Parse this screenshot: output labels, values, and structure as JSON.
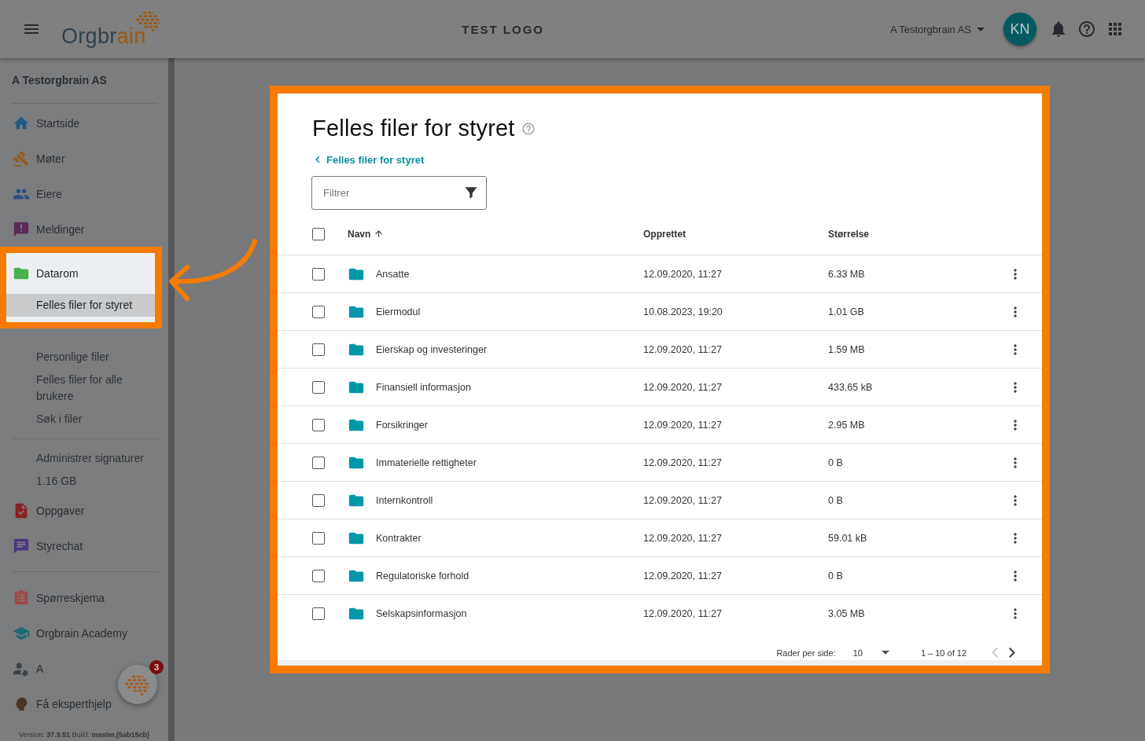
{
  "header": {
    "logo": [
      "Orgbr",
      "ain"
    ],
    "center_title": "TEST LOGO",
    "org_selector": "A Testorgbrain AS",
    "avatar": "KN"
  },
  "sidebar": {
    "org": "A Testorgbrain AS",
    "items": [
      {
        "kind": "nav",
        "label": "Startside",
        "selected": false,
        "highlighted": false
      },
      {
        "kind": "nav",
        "label": "Møter",
        "selected": false,
        "highlighted": false
      },
      {
        "kind": "nav",
        "label": "Eiere",
        "selected": false,
        "highlighted": false
      },
      {
        "kind": "nav",
        "label": "Meldinger",
        "selected": false,
        "highlighted": false
      },
      {
        "kind": "nav",
        "label": "Datarom",
        "selected": false,
        "highlighted": true
      },
      {
        "kind": "sub",
        "label": "Felles filer for styret",
        "selected": true,
        "highlighted": true
      },
      {
        "kind": "sub",
        "label": "Personlige filer",
        "selected": false,
        "highlighted": false
      },
      {
        "kind": "sub",
        "label": "Felles filer for alle brukere",
        "selected": false,
        "highlighted": false
      },
      {
        "kind": "sub",
        "label": "Søk i filer",
        "selected": false,
        "highlighted": false
      },
      {
        "kind": "divider"
      },
      {
        "kind": "sub",
        "label": "Administrer signaturer",
        "selected": false,
        "highlighted": false
      },
      {
        "kind": "sub",
        "label": "1.16 GB",
        "selected": false,
        "highlighted": false
      },
      {
        "kind": "nav",
        "label": "Oppgaver",
        "selected": false,
        "highlighted": false
      },
      {
        "kind": "nav",
        "label": "Styrechat",
        "selected": false,
        "highlighted": false
      },
      {
        "kind": "divider"
      },
      {
        "kind": "nav",
        "label": "Spørreskjema",
        "selected": false,
        "highlighted": false
      },
      {
        "kind": "nav",
        "label": "Orgbrain Academy",
        "selected": false,
        "highlighted": false
      },
      {
        "kind": "nav",
        "label": "A",
        "selected": false,
        "highlighted": false
      },
      {
        "kind": "nav",
        "label": "Få eksperthjelp",
        "selected": false,
        "highlighted": false
      }
    ],
    "chat_badge": "3",
    "version": "Version: **37.3.51** Build: **master,(5ab15cb)**"
  },
  "page": {
    "title": "Felles filer for styret",
    "breadcrumb": "Felles filer for styret",
    "filter": {
      "placeholder": "Filtrer"
    },
    "table": {
      "select_all": {
        "checked": false
      },
      "columns": [
        {
          "label": "Navn"
        },
        {
          "label": "Opprettet"
        },
        {
          "label": "Størrelse"
        }
      ],
      "rows": [
        {
          "name": "Ansatte",
          "created": "12.09.2020, 11:27",
          "size": "6.33 MB",
          "checked": false
        },
        {
          "name": "Eiermodul",
          "created": "10.08.2023, 19:20",
          "size": "1.01 GB",
          "checked": false
        },
        {
          "name": "Eierskap og investeringer",
          "created": "12.09.2020, 11:27",
          "size": "1.59 MB",
          "checked": false
        },
        {
          "name": "Finansiell informasjon",
          "created": "12.09.2020, 11:27",
          "size": "433.65 kB",
          "checked": false
        },
        {
          "name": "Forsikringer",
          "created": "12.09.2020, 11:27",
          "size": "2.95 MB",
          "checked": false
        },
        {
          "name": "Immaterielle rettigheter",
          "created": "12.09.2020, 11:27",
          "size": "0 B",
          "checked": false
        },
        {
          "name": "Internkontroll",
          "created": "12.09.2020, 11:27",
          "size": "0 B",
          "checked": false
        },
        {
          "name": "Kontrakter",
          "created": "12.09.2020, 11:27",
          "size": "59.01 kB",
          "checked": false
        },
        {
          "name": "Regulatoriske forhold",
          "created": "12.09.2020, 11:27",
          "size": "0 B",
          "checked": false
        },
        {
          "name": "Selskapsinformasjon",
          "created": "12.09.2020, 11:27",
          "size": "3.05 MB",
          "checked": false
        }
      ]
    },
    "pagination": {
      "rows_label": "Rader per side:",
      "page_size": "10",
      "range": "1 – 10 of 12",
      "prev": {
        "disabled": true
      },
      "next": {
        "disabled": false
      }
    }
  }
}
